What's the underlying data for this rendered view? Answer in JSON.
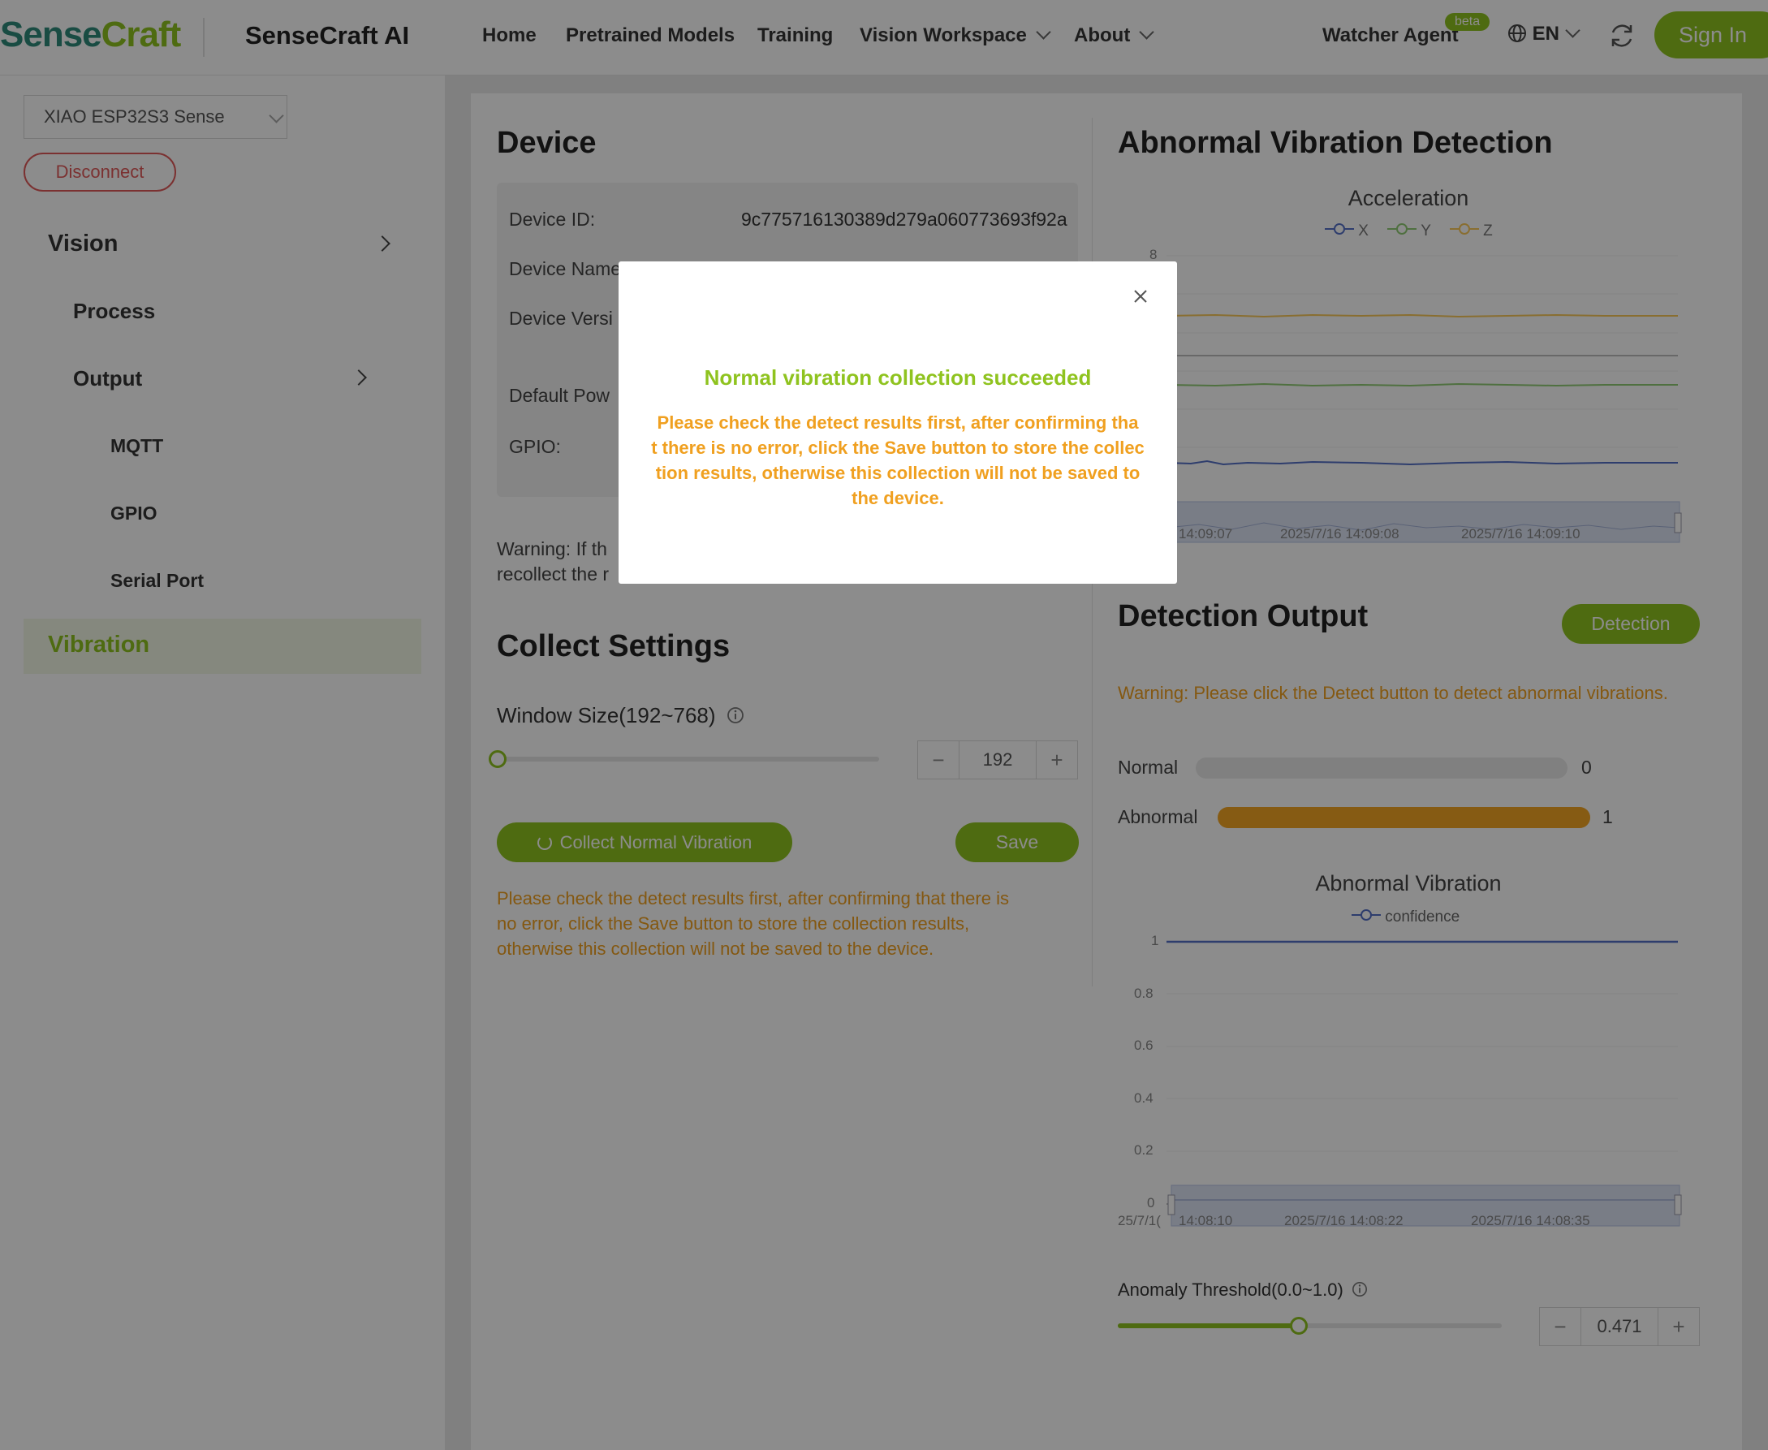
{
  "header": {
    "logo_part1": "Sense",
    "logo_part2": "Craft",
    "app_title": "SenseCraft AI",
    "nav": [
      "Home",
      "Pretrained Models",
      "Training",
      "Vision Workspace",
      "About"
    ],
    "watcher_agent": "Watcher Agent",
    "beta_badge": "beta",
    "language": "EN",
    "sign_in": "Sign In"
  },
  "sidebar": {
    "device_select": "XIAO ESP32S3 Sense",
    "disconnect": "Disconnect",
    "items": [
      {
        "label": "Vision"
      },
      {
        "label": "Process"
      },
      {
        "label": "Output"
      },
      {
        "label": "MQTT"
      },
      {
        "label": "GPIO"
      },
      {
        "label": "Serial Port"
      },
      {
        "label": "Vibration"
      }
    ]
  },
  "device": {
    "title": "Device",
    "device_id_label": "Device ID:",
    "device_id_value": "9c775716130389d279a060773693f92a",
    "device_name_label": "Device Name",
    "device_version_label": "Device Versi",
    "default_power_label": "Default Pow",
    "gpio_label": "GPIO:",
    "warning_line1": "Warning: If th",
    "warning_line2": "recollect the r"
  },
  "collect": {
    "title": "Collect Settings",
    "window_size_label": "Window Size(192~768)",
    "window_size_value": "192",
    "window_size_fraction": 0,
    "collect_button": "Collect Normal Vibration",
    "save_button": "Save",
    "notice_line1": "Please check the detect results first, after confirming that there is",
    "notice_line2": "no error, click the Save button to store the collection results,",
    "notice_line3": "otherwise this collection will not be saved to the device."
  },
  "vibration": {
    "title": "Abnormal Vibration Detection",
    "accel_chart_title": "Acceleration",
    "accel_legend": [
      "X",
      "Y",
      "Z"
    ],
    "accel_y_top": "8",
    "accel_time_labels": [
      "14:09:07",
      "2025/7/16 14:09:08",
      "2025/7/16 14:09:10"
    ]
  },
  "detection": {
    "title": "Detection Output",
    "button": "Detection",
    "warning": "Warning: Please click the Detect button to detect abnormal vibrations.",
    "normal_label": "Normal",
    "normal_count": "0",
    "abnormal_label": "Abnormal",
    "abnormal_count": "1",
    "abnormal_fill_fraction": 1.0,
    "confidence_chart_title": "Abnormal Vibration",
    "confidence_legend": "confidence",
    "confidence_y_ticks": [
      "1",
      "0.8",
      "0.6",
      "0.4",
      "0.2",
      "0"
    ],
    "confidence_time_labels": [
      "25/7/1(",
      "14:08:10",
      "2025/7/16 14:08:22",
      "2025/7/16 14:08:35"
    ],
    "threshold_label": "Anomaly Threshold(0.0~1.0)",
    "threshold_value": "0.471",
    "threshold_fraction": 0.471
  },
  "modal": {
    "title": "Normal vibration collection succeeded",
    "body_line1": "Please check the detect results first, after confirming tha",
    "body_line2": "t there is no error, click the Save button to store the collec",
    "body_line3": "tion results, otherwise this collection will not be saved to",
    "body_line4": "the device."
  },
  "colors": {
    "brand_green": "#8fc31f",
    "warning_orange": "#f0a020",
    "abnormal_bar": "#f5a623",
    "series_x": "#5470c6",
    "series_y": "#91cc75",
    "series_z": "#fac858"
  }
}
